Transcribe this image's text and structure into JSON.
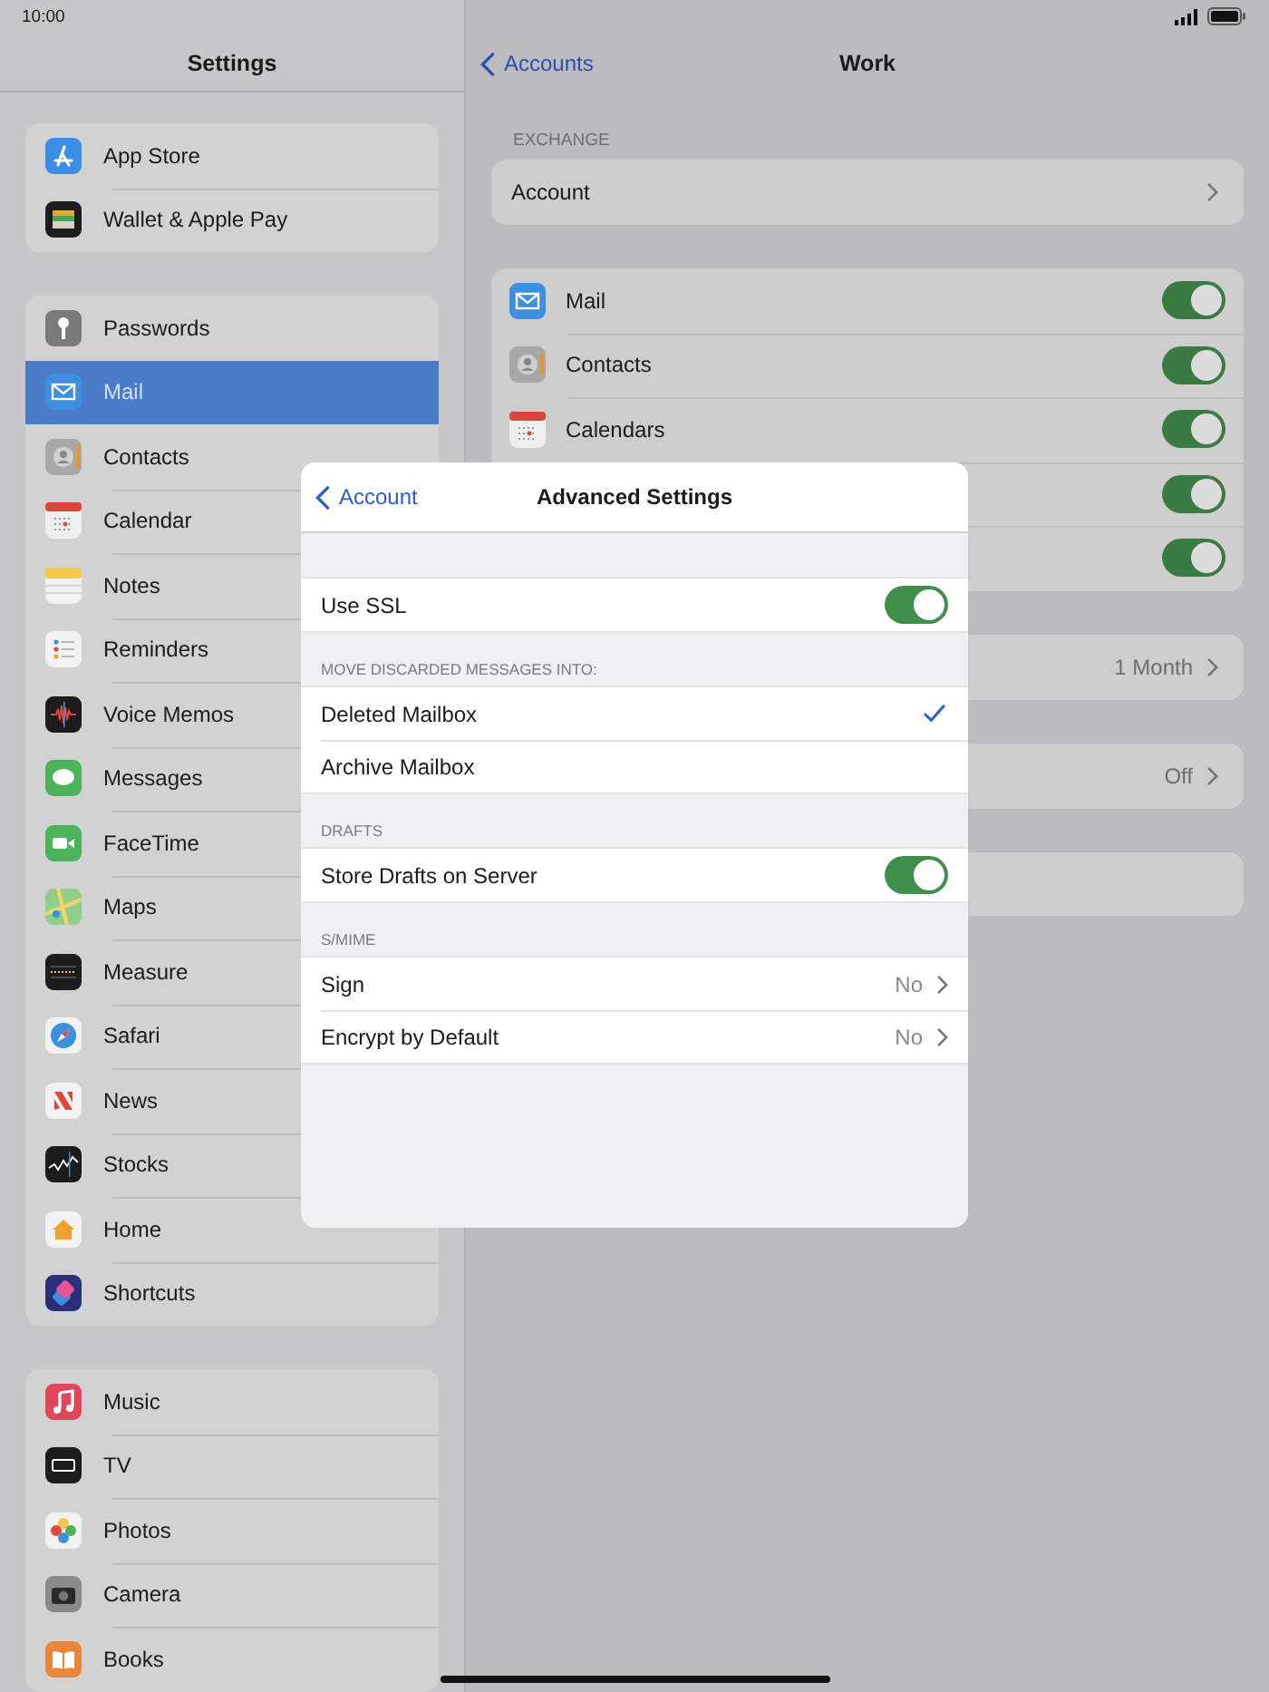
{
  "status_bar": {
    "time": "10:00"
  },
  "sidebar": {
    "title": "Settings",
    "groups": [
      {
        "items": [
          {
            "label": "App Store",
            "selected": false
          },
          {
            "label": "Wallet & Apple Pay",
            "selected": false
          }
        ]
      },
      {
        "items": [
          {
            "label": "Passwords",
            "selected": false
          },
          {
            "label": "Mail",
            "selected": true
          },
          {
            "label": "Contacts",
            "selected": false
          },
          {
            "label": "Calendar",
            "selected": false
          },
          {
            "label": "Notes",
            "selected": false
          },
          {
            "label": "Reminders",
            "selected": false
          },
          {
            "label": "Voice Memos",
            "selected": false
          },
          {
            "label": "Messages",
            "selected": false
          },
          {
            "label": "FaceTime",
            "selected": false
          },
          {
            "label": "Maps",
            "selected": false
          },
          {
            "label": "Measure",
            "selected": false
          },
          {
            "label": "Safari",
            "selected": false
          },
          {
            "label": "News",
            "selected": false
          },
          {
            "label": "Stocks",
            "selected": false
          },
          {
            "label": "Home",
            "selected": false
          },
          {
            "label": "Shortcuts",
            "selected": false
          }
        ]
      },
      {
        "items": [
          {
            "label": "Music",
            "selected": false
          },
          {
            "label": "TV",
            "selected": false
          },
          {
            "label": "Photos",
            "selected": false
          },
          {
            "label": "Camera",
            "selected": false
          },
          {
            "label": "Books",
            "selected": false
          }
        ]
      }
    ]
  },
  "detail": {
    "back": "Accounts",
    "title": "Work",
    "section_header": "EXCHANGE",
    "account_row": "Account",
    "sync_items": [
      {
        "label": "Mail",
        "on": true
      },
      {
        "label": "Contacts",
        "on": true
      },
      {
        "label": "Calendars",
        "on": true
      },
      {
        "on": true
      },
      {
        "on": true
      }
    ],
    "value_rows": [
      {
        "value": "1 Month"
      },
      {
        "value": "Off"
      }
    ]
  },
  "modal": {
    "back": "Account",
    "title": "Advanced Settings",
    "sections": [
      {
        "rows": [
          {
            "kind": "toggle",
            "label": "Use SSL",
            "on": true
          }
        ]
      },
      {
        "header": "MOVE DISCARDED MESSAGES INTO:",
        "rows": [
          {
            "kind": "choice",
            "label": "Deleted Mailbox",
            "selected": true
          },
          {
            "kind": "choice",
            "label": "Archive Mailbox",
            "selected": false
          }
        ]
      },
      {
        "header": "DRAFTS",
        "rows": [
          {
            "kind": "toggle",
            "label": "Store Drafts on Server",
            "on": true
          }
        ]
      },
      {
        "header": "S/MIME",
        "rows": [
          {
            "kind": "disclosure",
            "label": "Sign",
            "value": "No"
          },
          {
            "kind": "disclosure",
            "label": "Encrypt by Default",
            "value": "No"
          }
        ]
      }
    ]
  }
}
